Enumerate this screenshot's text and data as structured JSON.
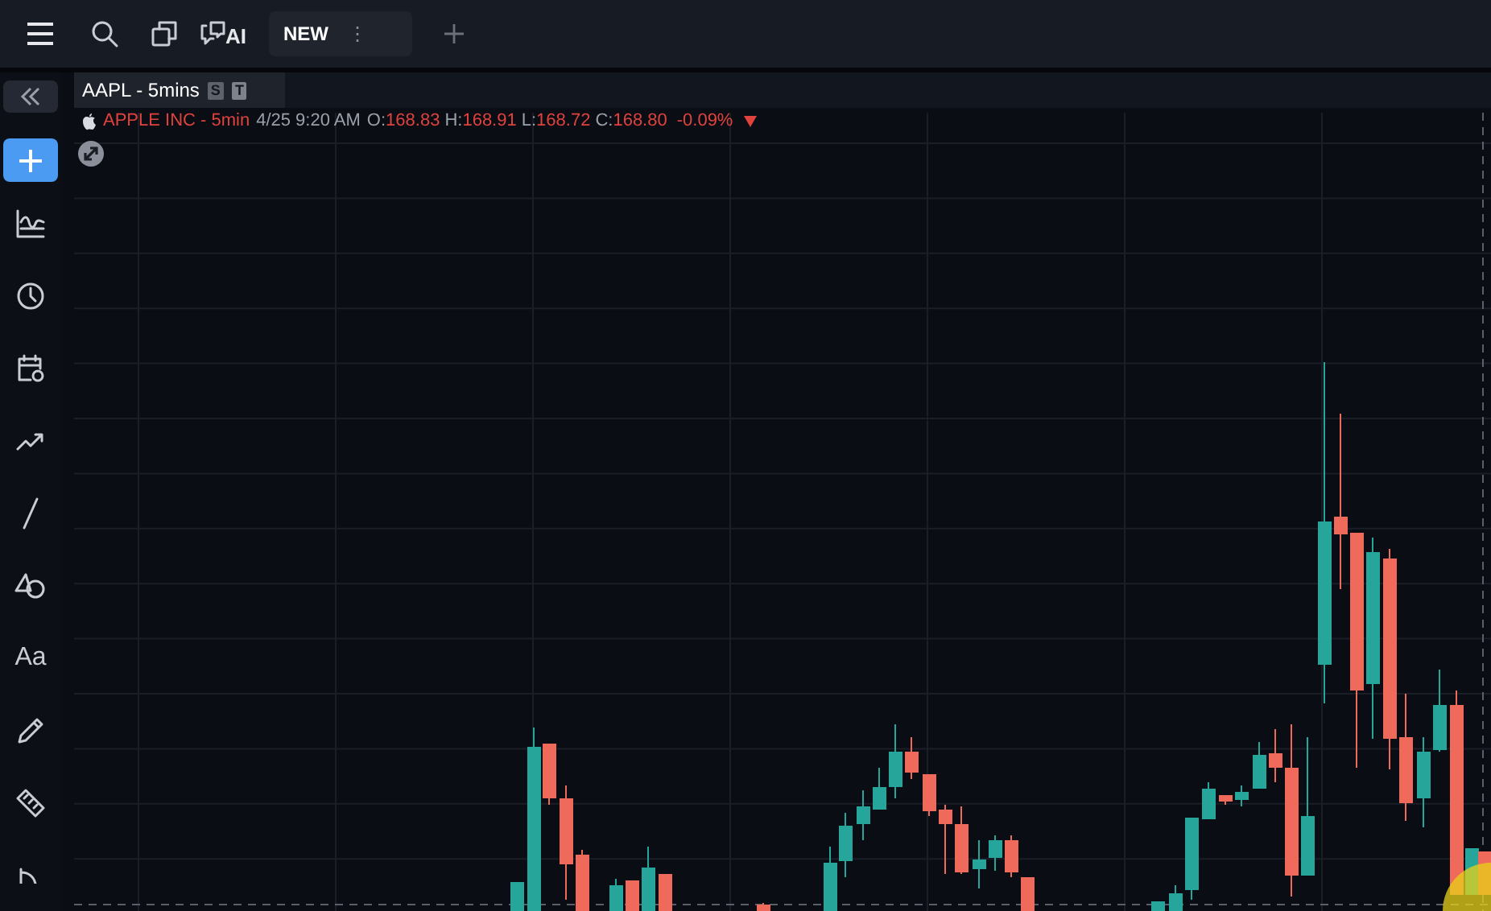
{
  "toolbar": {
    "ai_label": "AI",
    "tabs": [
      {
        "label": "NEW",
        "selected": true,
        "menu_glyph": "⋮"
      }
    ]
  },
  "sidebar": {
    "items": [
      {
        "kind": "collapse"
      },
      {
        "kind": "add"
      },
      {
        "kind": "indicator"
      },
      {
        "kind": "clock"
      },
      {
        "kind": "calendar"
      },
      {
        "kind": "trend"
      },
      {
        "kind": "line"
      },
      {
        "kind": "shapes"
      },
      {
        "kind": "text",
        "label": "Aa"
      },
      {
        "kind": "pencil"
      },
      {
        "kind": "ruler"
      },
      {
        "kind": "angle"
      }
    ]
  },
  "chart": {
    "tab": {
      "label": "AAPL - 5mins",
      "badges": [
        "S",
        "T"
      ]
    },
    "legend": {
      "name": "APPLE INC - 5min",
      "time": "4/25 9:20 AM",
      "values": [
        {
          "label": "O:",
          "value": "168.83"
        },
        {
          "label": "H:",
          "value": "168.91"
        },
        {
          "label": "L:",
          "value": "168.72"
        },
        {
          "label": "C:",
          "value": "168.80"
        }
      ],
      "change": "-0.09%"
    }
  }
}
